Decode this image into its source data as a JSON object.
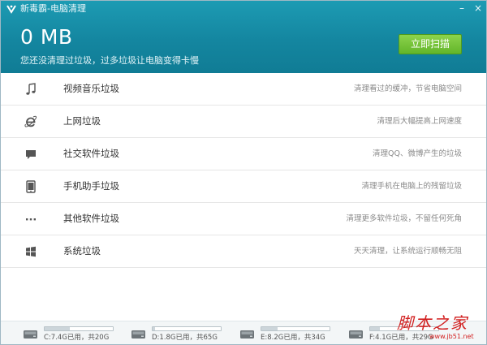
{
  "window": {
    "title": "新毒霸-电脑清理",
    "minimize_glyph": "–",
    "close_glyph": "×"
  },
  "header": {
    "size_value": "0 MB",
    "subtitle": "您还没清理过垃圾，过多垃圾让电脑变得卡慢",
    "scan_button_label": "立即扫描"
  },
  "items": [
    {
      "icon": "music-note-icon",
      "label": "视频音乐垃圾",
      "desc": "清理看过的缓冲，节省电脑空间"
    },
    {
      "icon": "browser-ie-icon",
      "label": "上网垃圾",
      "desc": "清理后大幅提高上网速度"
    },
    {
      "icon": "chat-bubble-icon",
      "label": "社交软件垃圾",
      "desc": "清理QQ、微博产生的垃圾"
    },
    {
      "icon": "phone-icon",
      "label": "手机助手垃圾",
      "desc": "清理手机在电脑上的残留垃圾"
    },
    {
      "icon": "more-dots-icon",
      "label": "其他软件垃圾",
      "desc": "清理更多软件垃圾，不留任何死角"
    },
    {
      "icon": "windows-logo-icon",
      "label": "系统垃圾",
      "desc": "天天清理，让系统运行顺畅无阻"
    }
  ],
  "drives": [
    {
      "text": "C:7.4G已用，共20G",
      "used_fraction": 0.37
    },
    {
      "text": "D:1.8G已用，共65G",
      "used_fraction": 0.03
    },
    {
      "text": "E:8.2G已用，共34G",
      "used_fraction": 0.24
    },
    {
      "text": "F:4.1G已用，共29G",
      "used_fraction": 0.14
    }
  ],
  "watermark": {
    "text": "脚本之家",
    "url": "www.jb51.net"
  },
  "colors": {
    "header_bg": "#1486a0",
    "scan_button": "#63b52a",
    "watermark": "#d21f1f"
  }
}
